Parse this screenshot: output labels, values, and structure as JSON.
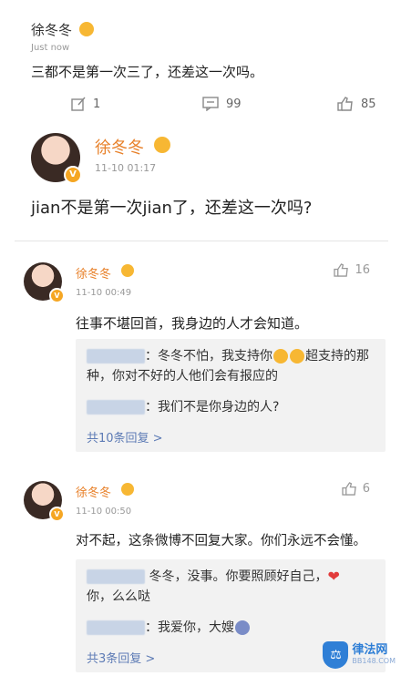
{
  "top_post": {
    "user": "徐冬冬",
    "time": "Just now",
    "text": "三都不是第一次三了，还差这一次吗。",
    "repost_count": "1",
    "comment_count": "99",
    "like_count": "85"
  },
  "main_post": {
    "user": "徐冬冬",
    "time": "11-10 01:17",
    "text": "jian不是第一次jian了，还差这一次吗?"
  },
  "comments": [
    {
      "user": "徐冬冬",
      "time": "11-10 00:49",
      "text": "往事不堪回首，我身边的人才会知道。",
      "likes": "16",
      "replies": [
        {
          "text_a": "：冬冬不怕，我支持你",
          "text_b": "超支持的那",
          "text_c": "种，你对不好的人他们会有报应的"
        },
        {
          "text_a": "：我们不是你身边的人?"
        }
      ],
      "more": "共10条回复 >"
    },
    {
      "user": "徐冬冬",
      "time": "11-10 00:50",
      "text": "对不起，这条微博不回复大家。你们永远不会懂。",
      "likes": "6",
      "replies": [
        {
          "text_a": "冬冬，没事。你要照顾好自己，",
          "text_b": "你，么么哒"
        },
        {
          "text_a": "：我爱你，大嫂"
        }
      ],
      "more": "共3条回复 >"
    }
  ],
  "watermark": {
    "title": "律法网",
    "sub": "BB148.COM"
  }
}
